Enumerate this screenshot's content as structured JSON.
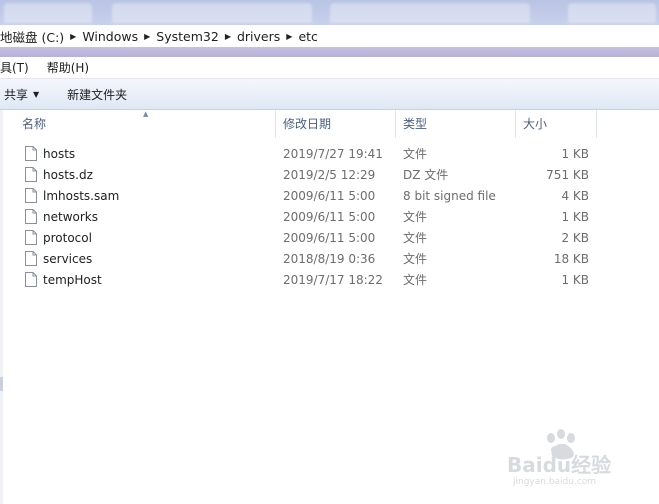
{
  "address_bar": {
    "crumbs": [
      "地磁盘 (C:)",
      "Windows",
      "System32",
      "drivers",
      "etc"
    ]
  },
  "menu": {
    "items": [
      "具(T)",
      "帮助(H)"
    ]
  },
  "toolbar": {
    "share_label": "共享",
    "new_folder_label": "新建文件夹"
  },
  "columns": {
    "name": "名称",
    "date": "修改日期",
    "type": "类型",
    "size": "大小"
  },
  "files": [
    {
      "name": "hosts",
      "date": "2019/7/27 19:41",
      "type": "文件",
      "size": "1 KB"
    },
    {
      "name": "hosts.dz",
      "date": "2019/2/5 12:29",
      "type": "DZ 文件",
      "size": "751 KB"
    },
    {
      "name": "lmhosts.sam",
      "date": "2009/6/11 5:00",
      "type": "8 bit signed file",
      "size": "4 KB"
    },
    {
      "name": "networks",
      "date": "2009/6/11 5:00",
      "type": "文件",
      "size": "1 KB"
    },
    {
      "name": "protocol",
      "date": "2009/6/11 5:00",
      "type": "文件",
      "size": "2 KB"
    },
    {
      "name": "services",
      "date": "2018/8/19 0:36",
      "type": "文件",
      "size": "18 KB"
    },
    {
      "name": "tempHost",
      "date": "2019/7/17 18:22",
      "type": "文件",
      "size": "1 KB"
    }
  ],
  "watermark": {
    "brand": "Baidu经验",
    "url": "jingyan.baidu.com"
  },
  "colors": {
    "tab_strip": "#c0c9e8",
    "toolbar_gradient_end": "#dfe8f5",
    "header_text": "#4c607a",
    "secondary_text": "#6d6d6d"
  }
}
